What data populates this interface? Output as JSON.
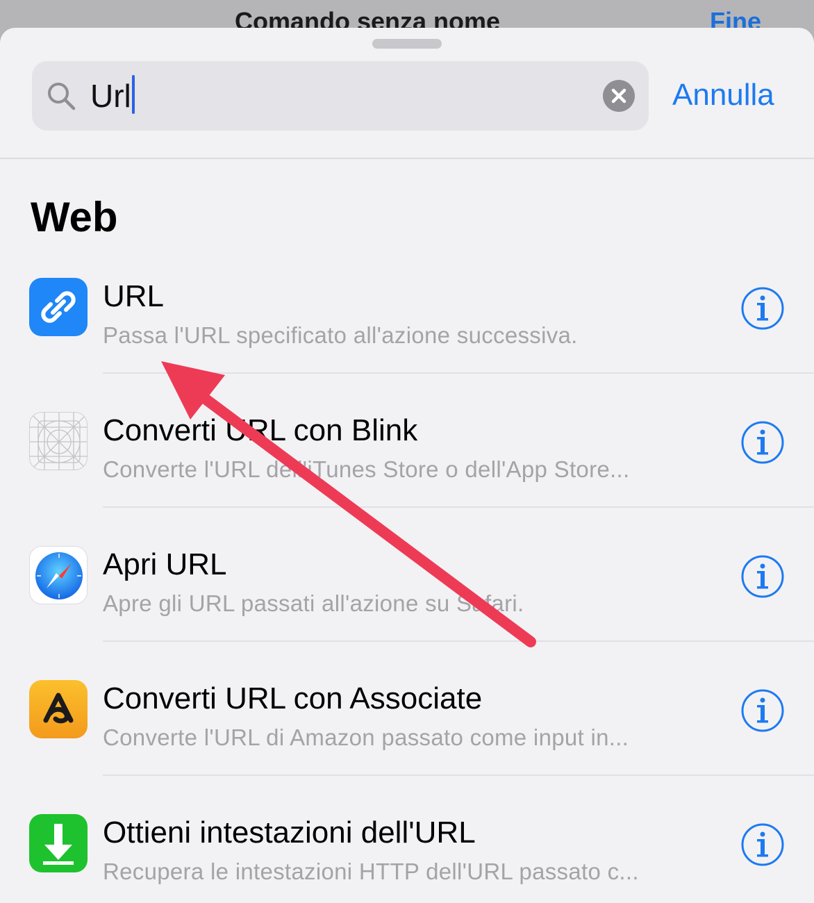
{
  "background": {
    "title": "Comando senza nome",
    "done_label": "Fine"
  },
  "search": {
    "value": "Url",
    "cancel_label": "Annulla"
  },
  "section": {
    "title": "Web"
  },
  "actions": [
    {
      "title": "URL",
      "subtitle": "Passa l'URL specificato all'azione successiva.",
      "icon": "link-icon",
      "color": "#1f87f7"
    },
    {
      "title": "Converti URL con Blink",
      "subtitle": "Converte l'URL dell'iTunes Store o dell'App Store...",
      "icon": "placeholder-grid-icon",
      "color": "#f4f4f6"
    },
    {
      "title": "Apri URL",
      "subtitle": "Apre gli URL passati all'azione su Safari.",
      "icon": "safari-compass-icon",
      "color": "#1a8cf5"
    },
    {
      "title": "Converti URL con Associate",
      "subtitle": "Converte l'URL di Amazon passato come input in...",
      "icon": "associate-logo-icon",
      "color": "#f9a825"
    },
    {
      "title": "Ottieni intestazioni dell'URL",
      "subtitle": "Recupera le intestazioni HTTP dell'URL passato c...",
      "icon": "download-arrow-icon",
      "color": "#1ec22e"
    }
  ],
  "colors": {
    "accent": "#1d7af0",
    "annotation_arrow": "#ee3b55"
  }
}
